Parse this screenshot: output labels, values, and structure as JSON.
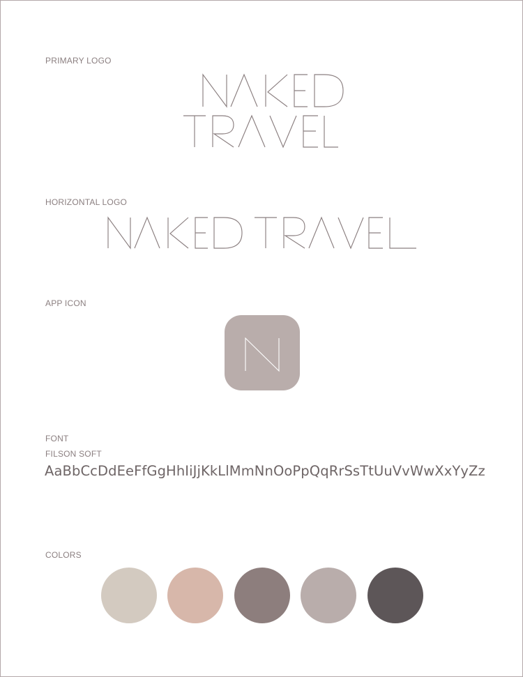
{
  "sections": {
    "primary_logo": "PRIMARY LOGO",
    "horizontal_logo": "HORIZONTAL LOGO",
    "app_icon": "APP ICON",
    "font": "FONT",
    "colors": "COLORS"
  },
  "logo": {
    "line1": "NAKED",
    "line2": "TRAVEL",
    "horizontal": "NAKED TRAVEL",
    "app_letter": "N"
  },
  "font": {
    "name": "FILSON SOFT",
    "sample": "AaBbCcDdEeFfGgHhIiJjKkLlMmNnOoPpQqRrSsTtUuVvWwXxYyZz"
  },
  "colors": {
    "app_icon": "#b9adab",
    "swatches": [
      "#d3cac0",
      "#d7b7aa",
      "#8d7e7d",
      "#b9adab",
      "#5d5658"
    ]
  }
}
